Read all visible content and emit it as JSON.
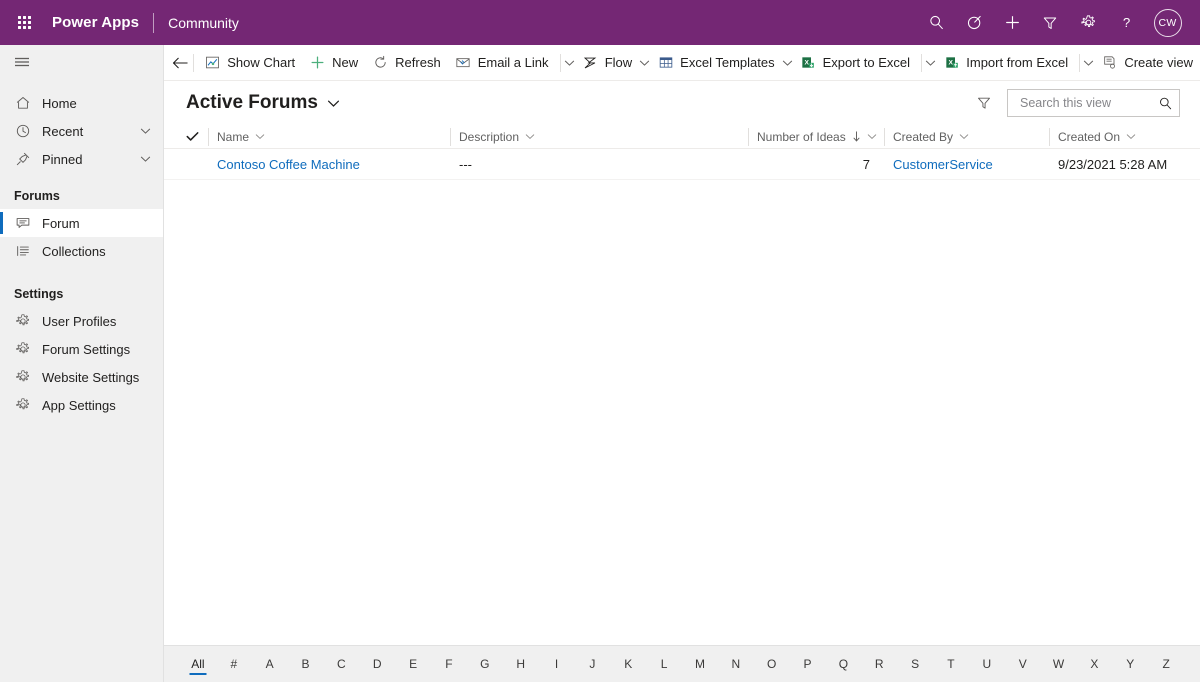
{
  "header": {
    "waffle_label": "App launcher",
    "brand": "Power Apps",
    "app_name": "Community",
    "icons": [
      {
        "name": "search-icon",
        "label": "Search"
      },
      {
        "name": "relevance-search-icon",
        "label": "Relevance"
      },
      {
        "name": "quick-create-icon",
        "label": "New"
      },
      {
        "name": "filter-icon",
        "label": "Filter"
      },
      {
        "name": "settings-gear-icon",
        "label": "Settings"
      },
      {
        "name": "help-icon",
        "label": "Help"
      }
    ],
    "avatar_initials": "CW",
    "purple": "#742774"
  },
  "sidebar": {
    "hamburger_label": "Expand / collapse",
    "top_items": [
      {
        "label": "Home",
        "icon": "home-icon",
        "chevron": false
      },
      {
        "label": "Recent",
        "icon": "clock-icon",
        "chevron": true
      },
      {
        "label": "Pinned",
        "icon": "pin-icon",
        "chevron": true
      }
    ],
    "groups": [
      {
        "title": "Forums",
        "items": [
          {
            "label": "Forum",
            "icon": "chat-bubble-icon",
            "selected": true
          },
          {
            "label": "Collections",
            "icon": "list-icon",
            "selected": false
          }
        ]
      },
      {
        "title": "Settings",
        "items": [
          {
            "label": "User Profiles",
            "icon": "gear-icon",
            "selected": false
          },
          {
            "label": "Forum Settings",
            "icon": "gear-icon",
            "selected": false
          },
          {
            "label": "Website Settings",
            "icon": "gear-icon",
            "selected": false
          },
          {
            "label": "App Settings",
            "icon": "gear-icon",
            "selected": false
          }
        ]
      }
    ],
    "accent": "#0f6cbd"
  },
  "commandbar": {
    "back_label": "Back",
    "buttons": [
      {
        "label": "Show Chart",
        "icon": "chart-icon",
        "caret": false
      },
      {
        "label": "New",
        "icon": "plus-icon",
        "caret": false
      },
      {
        "label": "Refresh",
        "icon": "refresh-icon",
        "caret": false
      },
      {
        "label": "Email a Link",
        "icon": "email-link-icon",
        "caret": true
      },
      {
        "label": "Flow",
        "icon": "flow-icon",
        "caret": true
      },
      {
        "label": "Excel Templates",
        "icon": "excel-template-icon",
        "caret": true
      },
      {
        "label": "Export to Excel",
        "icon": "excel-icon",
        "caret": true
      },
      {
        "label": "Import from Excel",
        "icon": "excel-import-icon",
        "caret": true
      },
      {
        "label": "Create view",
        "icon": "create-view-icon",
        "caret": false
      }
    ]
  },
  "view": {
    "title": "Active Forums",
    "filter_label": "Edit filters",
    "search_placeholder": "Search this view",
    "search_value": ""
  },
  "grid": {
    "select_all_label": "Select all",
    "columns": [
      {
        "key": "name",
        "label": "Name",
        "sort": "",
        "align": "left"
      },
      {
        "key": "description",
        "label": "Description",
        "sort": "",
        "align": "left"
      },
      {
        "key": "ideas",
        "label": "Number of Ideas",
        "sort": "desc",
        "align": "right"
      },
      {
        "key": "created_by",
        "label": "Created By",
        "sort": "",
        "align": "left"
      },
      {
        "key": "created_on",
        "label": "Created On",
        "sort": "",
        "align": "left"
      }
    ],
    "rows": [
      {
        "name": "Contoso Coffee Machine",
        "description": "---",
        "ideas": "7",
        "created_by": "CustomerService",
        "created_on": "9/23/2021 5:28 AM"
      }
    ]
  },
  "alphabar": {
    "active": "All",
    "items": [
      "All",
      "#",
      "A",
      "B",
      "C",
      "D",
      "E",
      "F",
      "G",
      "H",
      "I",
      "J",
      "K",
      "L",
      "M",
      "N",
      "O",
      "P",
      "Q",
      "R",
      "S",
      "T",
      "U",
      "V",
      "W",
      "X",
      "Y",
      "Z"
    ]
  }
}
